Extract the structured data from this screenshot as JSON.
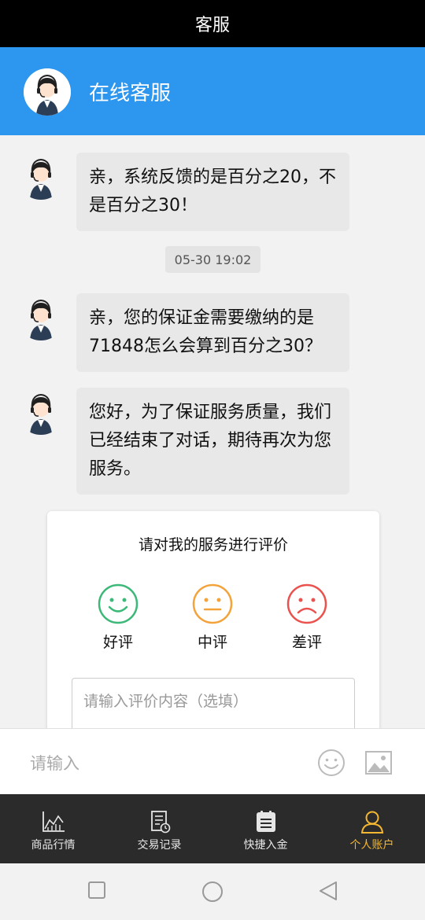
{
  "header": {
    "title": "客服"
  },
  "agent": {
    "name": "在线客服",
    "avatar_icon": "agent-avatar"
  },
  "messages": [
    {
      "text": "亲，系统反馈的是百分之20，不是百分之30！"
    },
    {
      "text": "亲，您的保证金需要缴纳的是71848怎么会算到百分之30？"
    },
    {
      "text": "您好，为了保证服务质量，我们已经结束了对话，期待再次为您服务。"
    }
  ],
  "timestamp": "05-30 19:02",
  "rating": {
    "title": "请对我的服务进行评价",
    "options": [
      {
        "label": "好评",
        "icon": "smile-face-icon",
        "color": "#3cb878"
      },
      {
        "label": "中评",
        "icon": "neutral-face-icon",
        "color": "#f3a33a"
      },
      {
        "label": "差评",
        "icon": "frown-face-icon",
        "color": "#e9524e"
      }
    ],
    "placeholder": "请输入评价内容（选填）"
  },
  "input": {
    "placeholder": "请输入",
    "emoji_icon": "emoji-icon",
    "image_icon": "image-icon"
  },
  "tabs": [
    {
      "label": "商品行情",
      "icon": "market-chart-icon"
    },
    {
      "label": "交易记录",
      "icon": "trade-record-icon"
    },
    {
      "label": "快捷入金",
      "icon": "quick-deposit-icon"
    },
    {
      "label": "个人账户",
      "icon": "account-icon",
      "active": true
    }
  ],
  "colors": {
    "accent_blue": "#2d96ee",
    "tab_active": "#f3b731",
    "tab_bg": "#2b2b2b"
  }
}
